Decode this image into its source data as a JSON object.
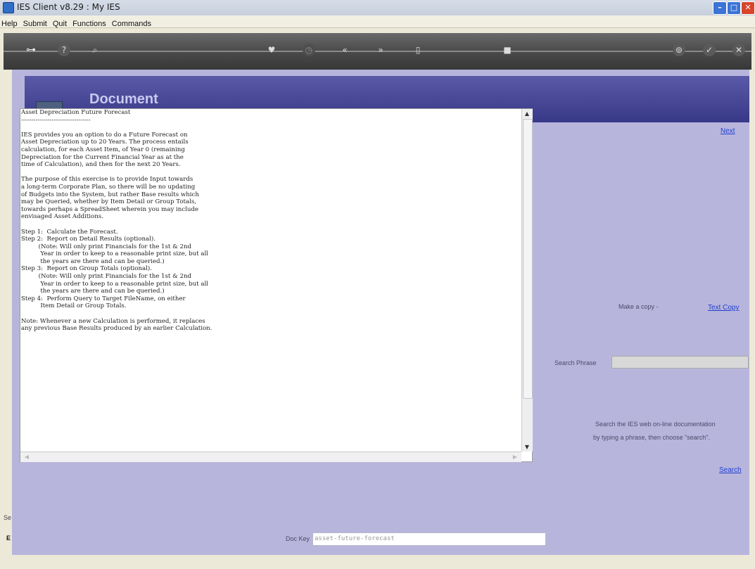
{
  "window": {
    "title": "IES Client v8.29 : My IES",
    "min_symbol": "–",
    "max_symbol": "□",
    "close_symbol": "✕"
  },
  "menu": [
    "Help",
    "Submit",
    "Quit",
    "Functions",
    "Commands"
  ],
  "toolbar": {
    "icons": [
      {
        "name": "key-icon",
        "glyph": "⊶"
      },
      {
        "name": "help-icon",
        "glyph": "?"
      },
      {
        "name": "search-icon",
        "glyph": "⌕"
      },
      {
        "name": "heart-icon",
        "glyph": "♥"
      },
      {
        "name": "clock-icon",
        "glyph": "◷"
      },
      {
        "name": "rewind-icon",
        "glyph": "«"
      },
      {
        "name": "forward-icon",
        "glyph": "»"
      },
      {
        "name": "trash-icon",
        "glyph": "▯"
      },
      {
        "name": "stop-icon",
        "glyph": "■"
      },
      {
        "name": "lock-icon",
        "glyph": "⊚"
      },
      {
        "name": "check-icon",
        "glyph": "✓"
      },
      {
        "name": "close-icon",
        "glyph": "✕"
      }
    ]
  },
  "header": {
    "title": "Document"
  },
  "links": {
    "next": "Next",
    "text_copy": "Text Copy",
    "search": "Search"
  },
  "labels": {
    "make_copy": "Make a copy -",
    "search_phrase": "Search Phrase",
    "search_help_1": "Search the IES web on-line documentation",
    "search_help_2": "by typing a phrase, then choose \"search\".",
    "doc_key": "Doc Key",
    "left_frag_1": "Se",
    "left_frag_2": "E"
  },
  "search": {
    "value": ""
  },
  "doc_key": {
    "value": "asset-future-forecast"
  },
  "document": {
    "text": "Asset Depreciation Future Forecast\n----------------------------------\n\nIES provides you an option to do a Future Forecast on\nAsset Depreciation up to 20 Years. The process entails\ncalculation, for each Asset Item, of Year 0 (remaining\nDepreciation for the Current Financial Year as at the\ntime of Calculation), and then for the next 20 Years.\n\nThe purpose of this exercise is to provide Input towards\na long-term Corporate Plan, so there will be no updating\nof Budgets into the System, but rather Base results which\nmay be Queried, whether by Item Detail or Group Totals,\ntowards perhaps a SpreadSheet wherein you may include\nenvisaged Asset Additions.\n\nStep 1:  Calculate the Forecast.\nStep 2:  Report on Detail Results (optional).\n         (Note: Will only print Financials for the 1st & 2nd\n          Year in order to keep to a reasonable print size, but all\n          the years are there and can be queried.)\nStep 3:  Report on Group Totals (optional).\n         (Note: Will only print Financials for the 1st & 2nd\n          Year in order to keep to a reasonable print size, but all\n          the years are there and can be queried.)\nStep 4:  Perform Query to Target FileName, on either\n          Item Detail or Group Totals.\n\nNote: Whenever a new Calculation is performed, it replaces\nany previous Base Results produced by an earlier Calculation."
  }
}
